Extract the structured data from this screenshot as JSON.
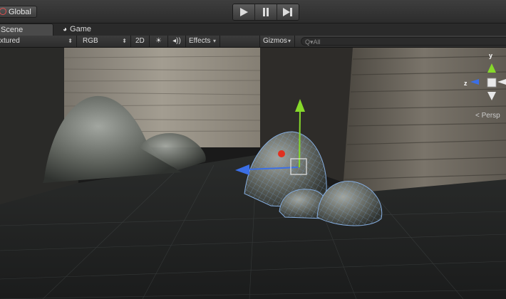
{
  "topbar": {
    "layer_button_label": "Global",
    "play_label": "play",
    "pause_label": "pause",
    "step_label": "step"
  },
  "tabs": [
    {
      "label": "Scene",
      "active": true
    },
    {
      "label": "Game",
      "active": false
    }
  ],
  "toolbar": {
    "draw_mode": "xtured",
    "render_mode": "RGB",
    "toggle_2d": "2D",
    "effects_label": "Effects",
    "gizmos_label": "Gizmos",
    "search_placeholder": "Q▾All"
  },
  "viewport": {
    "projection_label": "< Persp",
    "gizmo_axes": {
      "y": "y",
      "z": "z"
    }
  },
  "colors": {
    "x_axis": "#e03020",
    "y_axis": "#86d92a",
    "z_axis": "#3b6fe6"
  }
}
